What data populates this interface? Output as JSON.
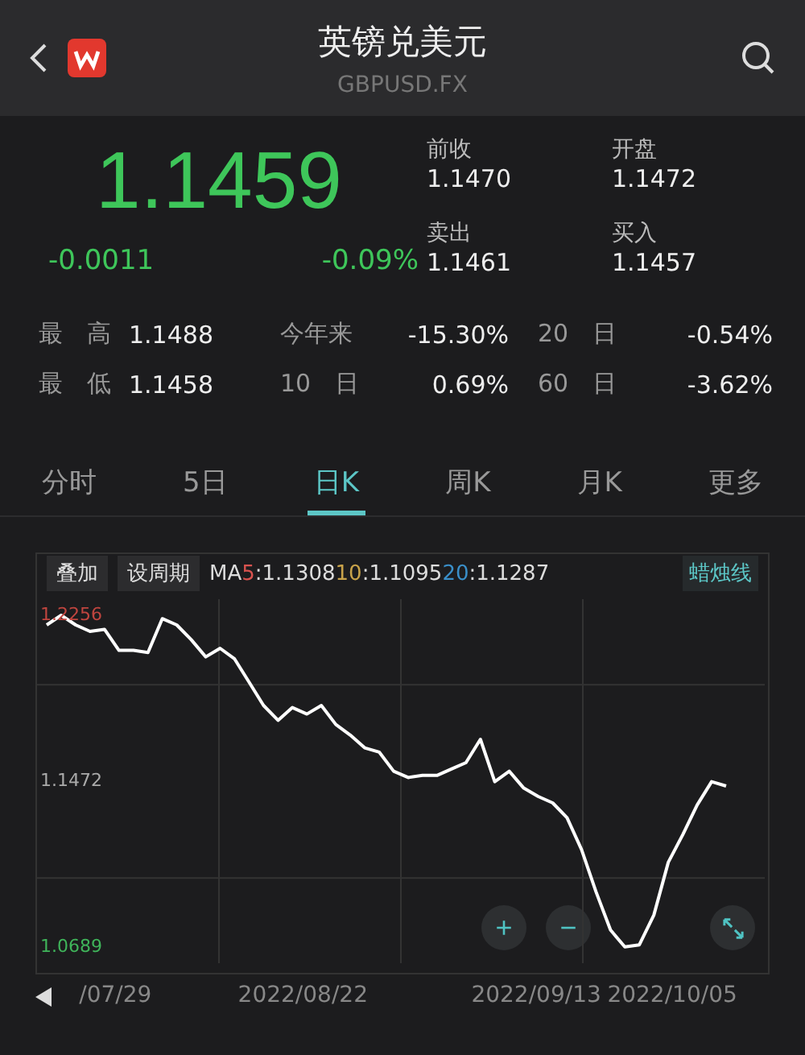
{
  "header": {
    "title": "英镑兑美元",
    "subtitle": "GBPUSD.FX"
  },
  "quote": {
    "price": "1.1459",
    "change": "-0.0011",
    "change_pct": "-0.09%",
    "fields": [
      {
        "label": "前收",
        "value": "1.1470"
      },
      {
        "label": "开盘",
        "value": "1.1472"
      },
      {
        "label": "卖出",
        "value": "1.1461"
      },
      {
        "label": "买入",
        "value": "1.1457"
      }
    ]
  },
  "stats": [
    [
      {
        "label": "最　高",
        "value": "1.1488"
      },
      {
        "label": "今年来",
        "value": "-15.30%"
      },
      {
        "label": "20　日",
        "value": "-0.54%"
      }
    ],
    [
      {
        "label": "最　低",
        "value": "1.1458"
      },
      {
        "label": "10　日",
        "value": "0.69%"
      },
      {
        "label": "60　日",
        "value": "-3.62%"
      }
    ]
  ],
  "tabs": [
    {
      "label": "分时",
      "selected": false
    },
    {
      "label": "5日",
      "selected": false
    },
    {
      "label": "日K",
      "selected": true
    },
    {
      "label": "周K",
      "selected": false
    },
    {
      "label": "月K",
      "selected": false
    },
    {
      "label": "更多",
      "selected": false
    }
  ],
  "chart_toolbar": {
    "buttons": [
      "叠加",
      "设周期"
    ],
    "ma_prefix": "MA",
    "ma": [
      {
        "period": "5",
        "value": ":1.1308",
        "color": "#d9534f"
      },
      {
        "period": "10",
        "value": ":1.1095",
        "color": "#c9a34a"
      },
      {
        "period": "20",
        "value": ":1.1287",
        "color": "#3a8fc9"
      }
    ],
    "mode": "蜡烛线"
  },
  "chart": {
    "chart_data": {
      "type": "line",
      "ylim": [
        1.0613,
        1.2332
      ],
      "yticks": [
        {
          "value": 1.2256,
          "label": "1.2256"
        },
        {
          "value": 1.1472,
          "label": "1.1472"
        },
        {
          "value": 1.0689,
          "label": "1.0689"
        }
      ],
      "series": [
        {
          "color": "#ffffff",
          "values": [
            1.221,
            1.2256,
            1.221,
            1.218,
            1.219,
            1.209,
            1.209,
            1.208,
            1.224,
            1.221,
            1.214,
            1.206,
            1.21,
            1.205,
            1.194,
            1.183,
            1.176,
            1.182,
            1.179,
            1.183,
            1.174,
            1.169,
            1.163,
            1.161,
            1.152,
            1.149,
            1.15,
            1.15,
            1.153,
            1.156,
            1.167,
            1.147,
            1.152,
            1.144,
            1.14,
            1.137,
            1.13,
            1.115,
            1.095,
            1.077,
            1.069,
            1.07,
            1.084,
            1.109,
            1.122,
            1.136,
            1.147,
            1.145
          ]
        }
      ]
    },
    "date_labels": [
      "/07/29",
      "2022/08/22",
      "2022/09/13",
      "2022/10/05"
    ],
    "controls": [
      {
        "kind": "zoom-in",
        "label": "+"
      },
      {
        "kind": "zoom-out",
        "label": "−"
      },
      {
        "kind": "expand"
      }
    ]
  }
}
